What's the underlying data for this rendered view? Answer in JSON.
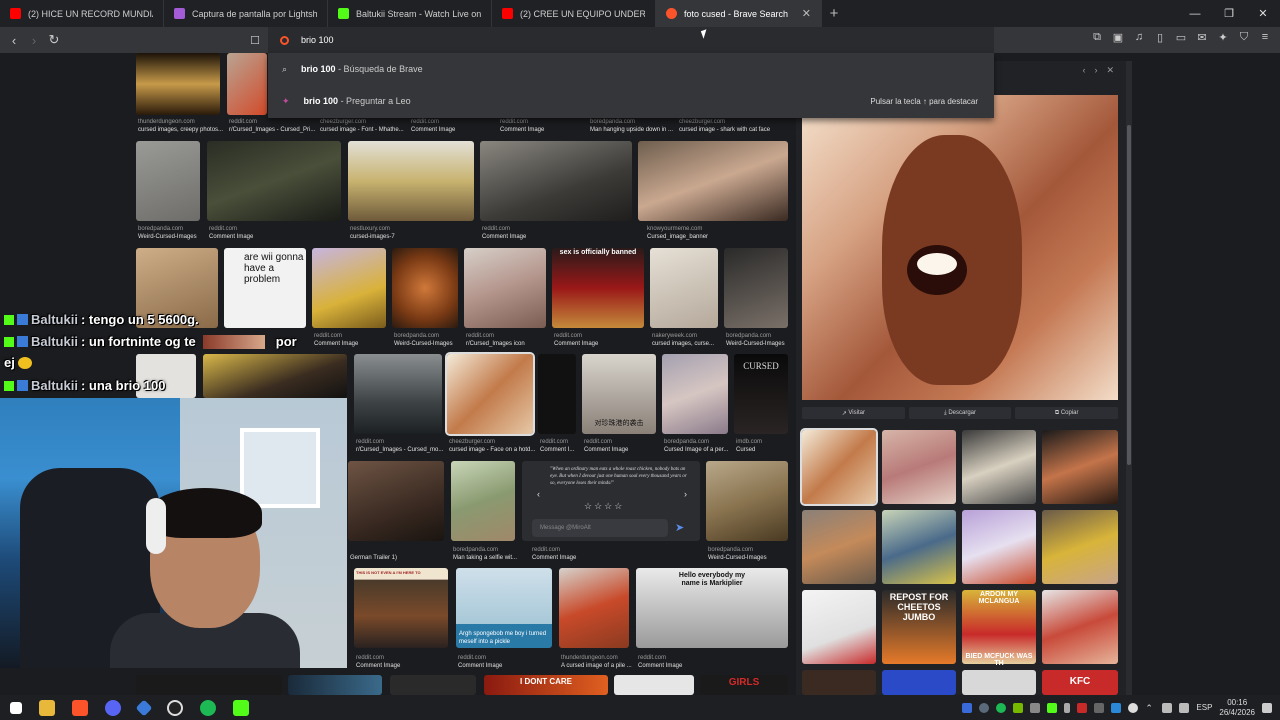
{
  "browser": {
    "tabs": [
      {
        "label": "(2) HICE UN RECORD MUNDIAL EN M",
        "icon": "youtube-icon",
        "color": "#ff0000"
      },
      {
        "label": "Captura de pantalla por Lightshot",
        "icon": "lightshot-icon",
        "color": "#a35bd6"
      },
      {
        "label": "Baltukii Stream - Watch Live on Kick",
        "icon": "kick-icon",
        "color": "#53fc18"
      },
      {
        "label": "(2) CREE UN EQUIPO UNDER EN EL F",
        "icon": "youtube-icon",
        "color": "#ff0000"
      },
      {
        "label": "foto cused - Brave Search",
        "icon": "brave-search-icon",
        "color": "#fb542b",
        "active": true
      }
    ],
    "new_tab_label": "+",
    "url_value": "brio 100",
    "suggestions": [
      {
        "bold": "brio 100",
        "rest": " - Búsqueda de Brave"
      },
      {
        "bold": "brio 100",
        "rest": " - Preguntar a Leo"
      }
    ],
    "suggest_hint": "Pulsar la tecla ↑ para destacar"
  },
  "results": {
    "row1": [
      {
        "source": "thunderdungeon.com",
        "title": "cursed images, creepy photos..."
      },
      {
        "source": "reddit.com",
        "title": "r/Cursed_Images - Cursed_Pri..."
      },
      {
        "source": "cheezburger.com",
        "title": "cursed image - Font - Mhathe..."
      },
      {
        "source": "reddit.com",
        "title": "Comment Image"
      },
      {
        "source": "reddit.com",
        "title": "Comment Image"
      },
      {
        "source": "boredpanda.com",
        "title": "Man hanging upside down in ..."
      },
      {
        "source": "cheezburger.com",
        "title": "cursed image - shark with cat face"
      }
    ],
    "row2": [
      {
        "source": "boredpanda.com",
        "title": "Weird-Cursed-Images"
      },
      {
        "source": "reddit.com",
        "title": "Comment Image"
      },
      {
        "source": "nestluxury.com",
        "title": "cursed-images-7"
      },
      {
        "source": "reddit.com",
        "title": "Comment Image"
      },
      {
        "source": "knowyourmeme.com",
        "title": "Cursed_image_banner"
      }
    ],
    "row3": [
      {
        "source": "reddit.com",
        "title": "Comment Image"
      },
      {
        "source": "boredpanda.com",
        "title": "Weird-Cursed-Images"
      },
      {
        "source": "reddit.com",
        "title": "r/Cursed_Images icon"
      },
      {
        "source": "reddit.com",
        "title": "Comment Image"
      },
      {
        "source": "nakeryweek.com",
        "title": "cursed images, curse..."
      },
      {
        "source": "boredpanda.com",
        "title": "Weird-Cursed-Images"
      }
    ],
    "row3_texts": {
      "wii": "are wii gonna have a problem",
      "sex": "sex is officially banned"
    },
    "row4": [
      {
        "source": "reddit.com",
        "title": "r/Cursed_Images - Cursed_mo..."
      },
      {
        "source": "cheezburger.com",
        "title": "cursed image - Face on a hotd..."
      },
      {
        "source": "reddit.com",
        "title": "Comment I..."
      },
      {
        "source": "reddit.com",
        "title": "Comment Image"
      },
      {
        "source": "boredpanda.com",
        "title": "Cursed Image of a per..."
      },
      {
        "source": "imdb.com",
        "title": "Cursed"
      }
    ],
    "row4_texts": {
      "cursed": "CURSED",
      "chinese": "对珍珠港的袭击"
    },
    "row5": [
      {
        "source": "",
        "title": "German Trailer 1)"
      },
      {
        "source": "boredpanda.com",
        "title": "Man taking a selfie wit..."
      },
      {
        "source": "reddit.com",
        "title": "Comment Image"
      },
      {
        "source": "boredpanda.com",
        "title": "Weird-Cursed-Images"
      }
    ],
    "row5_texts": {
      "quote": "\"When an ordinary man eats a whole roast chicken, nobody bats an eye. But when I devour just one human soul every thousand years or so, everyone loses their minds!\"",
      "message_placeholder": "Message @MiroAlt"
    },
    "row6": [
      {
        "source": "reddit.com",
        "title": "Comment Image"
      },
      {
        "source": "reddit.com",
        "title": "Comment Image"
      },
      {
        "source": "thunderdungeon.com",
        "title": "A cursed image of a pile ..."
      },
      {
        "source": "reddit.com",
        "title": "Comment Image"
      }
    ],
    "row6_texts": {
      "spongebob": "Argh spongebob me boy i turned meself into a pickle",
      "markiplier": "Hello everybody my name is Markiplier",
      "hit": "THIS IS NOT EVEN A I'M HERE TO"
    },
    "row7_texts": {
      "dont_care": "I DONT CARE",
      "girls": "GIRLS"
    }
  },
  "preview": {
    "buttons": [
      "Visitar",
      "Descargar",
      "Copiar"
    ],
    "related_texts": {
      "cheetos": "REPOST FOR CHEETOS JUMBO",
      "mclanguage": "ARDON MY MCLANGUA",
      "mcfuck": "BIED MCFUCK WAS TH",
      "kfc": "KFC"
    }
  },
  "chat": [
    {
      "user": "Baltukii",
      "message": ": tengo un 5 5600g."
    },
    {
      "user": "Baltukii",
      "message": ": un fortninte og te"
    },
    {
      "user": "Baltukii",
      "message": ": una brio 100"
    }
  ],
  "chat_fragments": {
    "por": "por",
    "ej": "ej"
  },
  "taskbar": {
    "apps": [
      "windows-start-icon",
      "file-explorer-icon",
      "brave-icon",
      "discord-icon",
      "app-icon",
      "obs-icon",
      "spotify-icon",
      "kick-icon"
    ],
    "lang": "ESP",
    "time": "00:16",
    "date": "26/4/2026"
  },
  "colors": {
    "kick": "#53fc18",
    "accent": "#fb542b"
  }
}
